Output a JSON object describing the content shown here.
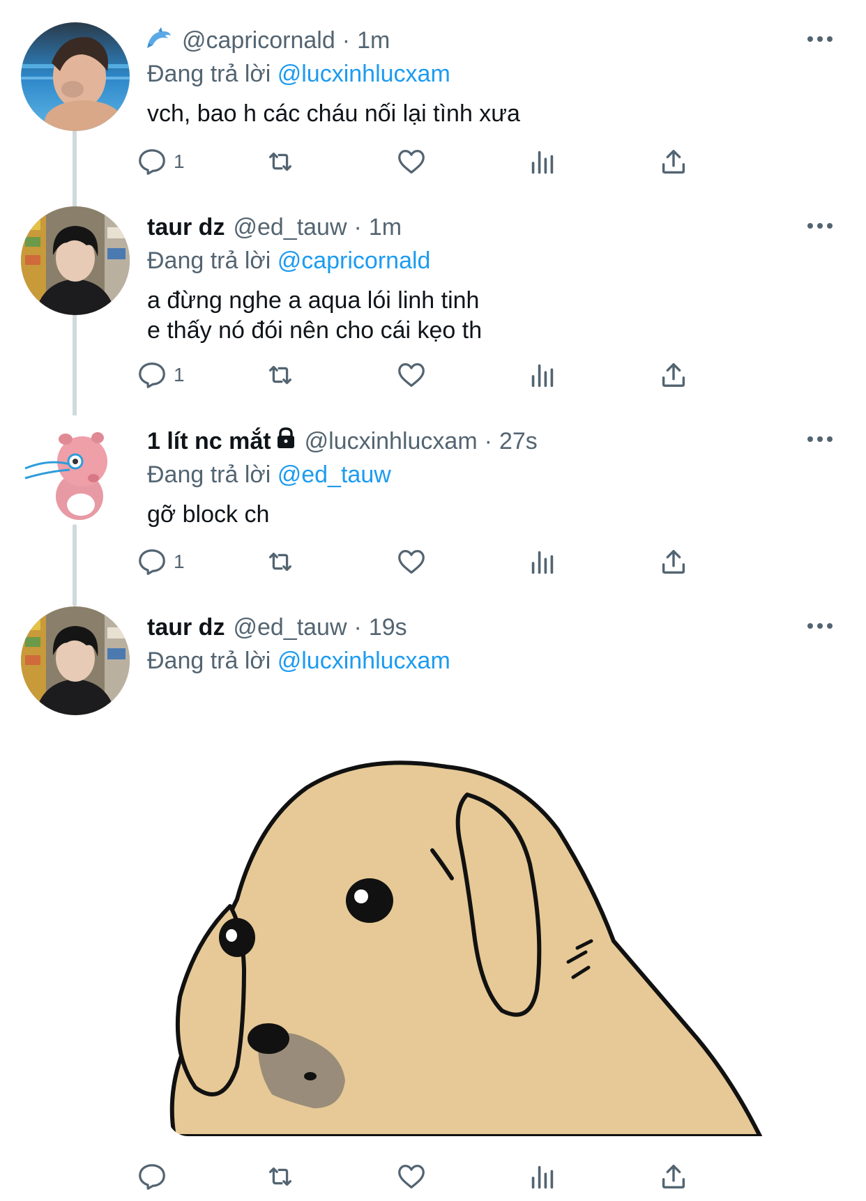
{
  "tweets": [
    {
      "name_emoji": "🐬",
      "display_name": "",
      "handle": "@capricornald",
      "time": "1m",
      "reply_prefix": "Đang trả lời",
      "reply_to": "@lucxinhlucxam",
      "text_lines": [
        "vch, bao h các cháu nối lại tình xưa"
      ],
      "reply_count": "1",
      "avatar_icon": "swimmer-photo"
    },
    {
      "display_name": "taur dz",
      "handle": "@ed_tauw",
      "time": "1m",
      "reply_prefix": "Đang trả lời",
      "reply_to": "@capricornald",
      "text_lines": [
        "a đừng nghe a aqua lói linh tinh",
        "e thấy nó đói nên cho cái kẹo th"
      ],
      "reply_count": "1",
      "avatar_icon": "man-hoodie-photo"
    },
    {
      "display_name": "1 lít nc mắt",
      "locked": true,
      "handle": "@lucxinhlucxam",
      "time": "27s",
      "reply_prefix": "Đang trả lời",
      "reply_to": "@ed_tauw",
      "text_lines": [
        "gỡ block ch"
      ],
      "reply_count": "1",
      "avatar_icon": "pink-beaver-cartoon"
    },
    {
      "display_name": "taur dz",
      "handle": "@ed_tauw",
      "time": "19s",
      "reply_prefix": "Đang trả lời",
      "reply_to": "@lucxinhlucxam",
      "text_lines": [],
      "reply_count": "",
      "avatar_icon": "man-hoodie-photo",
      "media": "cartoon-dog-sticker"
    }
  ],
  "icons": {
    "reply": "reply-icon",
    "retweet": "retweet-icon",
    "like": "heart-icon",
    "views": "views-icon",
    "share": "share-icon",
    "more": "more-icon",
    "lock": "lock-icon"
  },
  "colors": {
    "mention": "#1d9bf0",
    "secondary": "#536471",
    "thread_line": "#cfd9de",
    "dog_fur": "#e6c996",
    "dog_nose": "#9a8c7a"
  }
}
